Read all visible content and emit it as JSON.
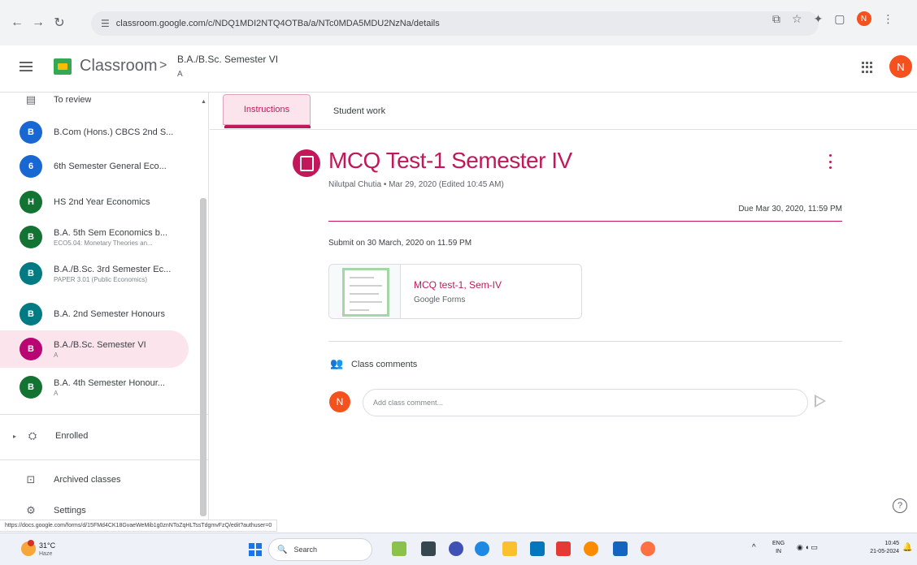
{
  "browser": {
    "url": "classroom.google.com/c/NDQ1MDI2NTQ4OTBa/a/NTc0MDA5MDU2NzNa/details"
  },
  "header": {
    "app_name": "Classroom",
    "breadcrumb_separator": ">",
    "class_title": "B.A./B.Sc. Semester VI",
    "class_section": "A",
    "avatar_initial": "N"
  },
  "sidebar": {
    "to_review": "To review",
    "classes": [
      {
        "initial": "B",
        "color": "#1967d2",
        "title": "B.Com (Hons.) CBCS 2nd S...",
        "subtitle": ""
      },
      {
        "initial": "6",
        "color": "#1967d2",
        "title": "6th Semester General Eco...",
        "subtitle": ""
      },
      {
        "initial": "H",
        "color": "#137333",
        "title": "HS 2nd Year Economics",
        "subtitle": ""
      },
      {
        "initial": "B",
        "color": "#137333",
        "title": "B.A. 5th Sem Economics b...",
        "subtitle": "ECO5.04: Monetary Theories an..."
      },
      {
        "initial": "B",
        "color": "#007b83",
        "title": "B.A./B.Sc. 3rd Semester Ec...",
        "subtitle": "PAPER 3.01 (Public Economics)"
      },
      {
        "initial": "B",
        "color": "#007b83",
        "title": "B.A. 2nd Semester Honours",
        "subtitle": ""
      },
      {
        "initial": "B",
        "color": "#b80672",
        "title": "B.A./B.Sc. Semester VI",
        "subtitle": "A"
      },
      {
        "initial": "B",
        "color": "#137333",
        "title": "B.A. 4th Semester Honour...",
        "subtitle": "A"
      }
    ],
    "enrolled": "Enrolled",
    "archived": "Archived classes",
    "settings": "Settings"
  },
  "tabs": {
    "instructions": "Instructions",
    "student_work": "Student work"
  },
  "assignment": {
    "title": "MCQ Test-1 Semester IV",
    "meta": "Nilutpal Chutia • Mar 29, 2020 (Edited 10:45 AM)",
    "due": "Due Mar 30, 2020, 11:59 PM",
    "instructions": "Submit on 30 March, 2020 on 11.59 PM",
    "attachment_title": "MCQ test-1, Sem-IV",
    "attachment_type": "Google Forms"
  },
  "comments": {
    "label": "Class comments",
    "avatar_initial": "N",
    "placeholder": "Add class comment..."
  },
  "status_url": "https://docs.google.com/forms/d/15FMd4CK18GvaeWeMib1g0znNToZqHLTssTdgmvFzQ/edit?authuser=0",
  "taskbar": {
    "temperature": "31°C",
    "condition": "Haze",
    "search_label": "Search",
    "lang_top": "ENG",
    "lang_bottom": "IN",
    "time": "10:45",
    "date": "21-05-2024"
  },
  "colors": {
    "accent": "#c2185b",
    "accent_light": "#fce4ec"
  }
}
